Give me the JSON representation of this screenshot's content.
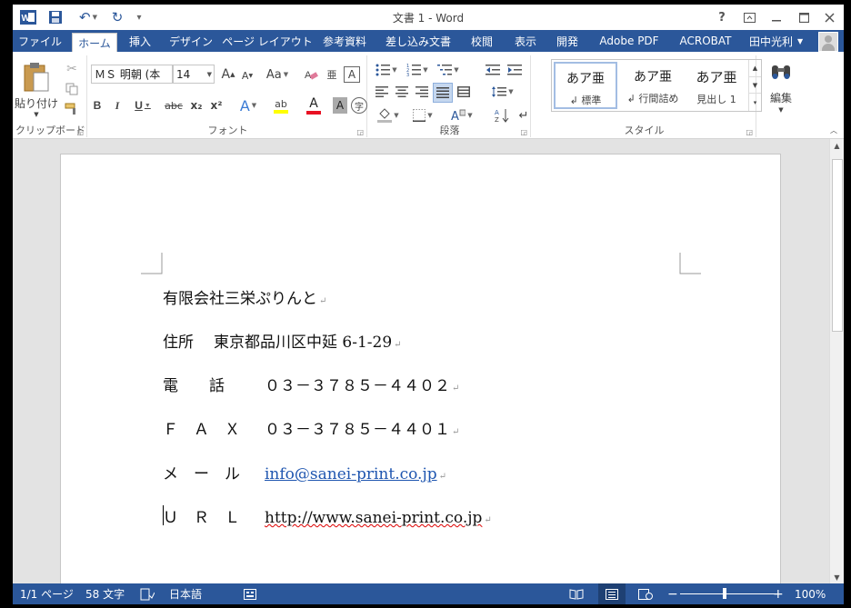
{
  "window": {
    "title": "文書 1 - Word"
  },
  "qat": {
    "undo_icon": "undo-icon",
    "redo_icon": "redo-icon",
    "customize": "▾"
  },
  "title_controls": {
    "help": "?",
    "ribbon_display": "⊡",
    "minimize": "—",
    "maximize": "□",
    "close": "✕"
  },
  "tabs": [
    "ファイル",
    "ホーム",
    "挿入",
    "デザイン",
    "ページ レイアウト",
    "参考資料",
    "差し込み文書",
    "校閲",
    "表示",
    "開発",
    "Adobe PDF",
    "ACROBAT"
  ],
  "active_tab": "ホーム",
  "user": {
    "name": "田中光利"
  },
  "ribbon": {
    "clipboard": {
      "label": "クリップボード",
      "paste": "貼り付け"
    },
    "font": {
      "label": "フォント",
      "font_name": "ＭＳ 明朝 (本",
      "font_size": "14",
      "grow": "A",
      "shrink": "A",
      "change_case": "Aa",
      "bold": "B",
      "italic": "I",
      "underline": "U",
      "strike": "abc",
      "subscript": "x₂",
      "superscript": "x²",
      "text_effects": "A",
      "highlight": "ab",
      "font_color": "A",
      "char_shading": "A",
      "enclose": "字"
    },
    "paragraph": {
      "label": "段落"
    },
    "styles": {
      "label": "スタイル",
      "items": [
        {
          "preview": "あア亜",
          "name": "↲ 標準"
        },
        {
          "preview": "あア亜",
          "name": "↲ 行間詰め"
        },
        {
          "preview": "あア亜",
          "name": "見出し 1"
        }
      ]
    },
    "editing": {
      "label": "編集"
    }
  },
  "document": {
    "company": "有限会社三栄ぷりんと",
    "address_label": "住所",
    "address_value": "東京都品川区中延 6-1-29",
    "tel_label": "電　　話",
    "tel_value": "０３－３７８５－４４０２",
    "fax_label": "Ｆ　Ａ　Ｘ",
    "fax_value": "０３－３７８５－４４０１",
    "mail_label": "メ　ー　ル",
    "mail_value": "info@sanei-print.co.jp",
    "url_label": "Ｕ　Ｒ　Ｌ",
    "url_value": "http://www.sanei-print.co.jp",
    "para_mark": "↵"
  },
  "status": {
    "page": "1/1 ページ",
    "words": "58 文字",
    "language": "日本語",
    "zoom": "100%",
    "zoom_minus": "−",
    "zoom_plus": "+"
  },
  "colors": {
    "accent": "#2b579a",
    "link": "#1f56b0"
  }
}
